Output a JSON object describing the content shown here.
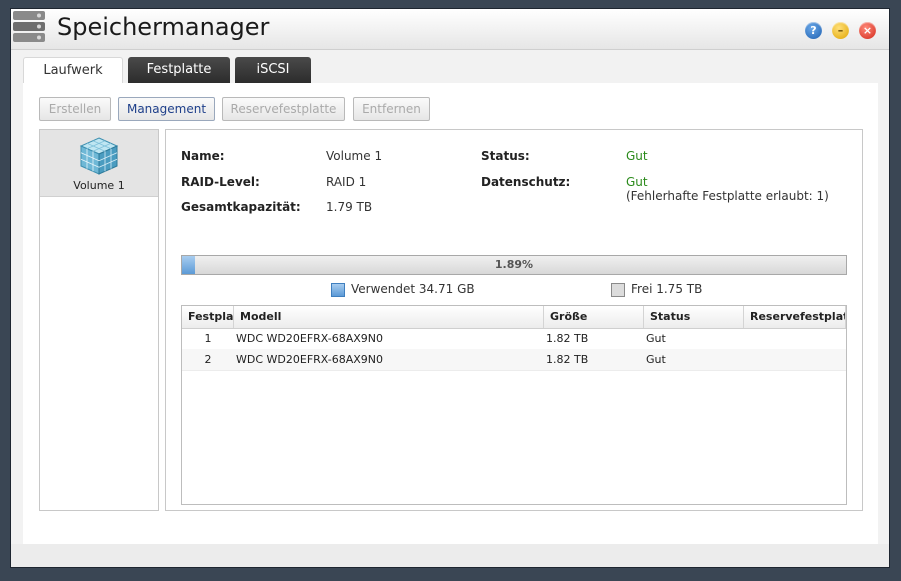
{
  "window": {
    "title": "Speichermanager"
  },
  "window_buttons": {
    "help": "?",
    "minimize": "–",
    "close": "×"
  },
  "tabs": [
    {
      "label": "Laufwerk",
      "active": true
    },
    {
      "label": "Festplatte",
      "active": false
    },
    {
      "label": "iSCSI",
      "active": false
    }
  ],
  "toolbar": {
    "create": "Erstellen",
    "management": "Management",
    "spare": "Reservefestplatte",
    "remove": "Entfernen"
  },
  "volumes": [
    {
      "label": "Volume 1"
    }
  ],
  "details": {
    "name_label": "Name:",
    "name_value": "Volume 1",
    "raid_label": "RAID-Level:",
    "raid_value": "RAID 1",
    "capacity_label": "Gesamtkapazität:",
    "capacity_value": "1.79 TB",
    "status_label": "Status:",
    "status_value": "Gut",
    "protection_label": "Datenschutz:",
    "protection_value": "Gut",
    "protection_note": "(Fehlerhafte Festplatte erlaubt: 1)"
  },
  "usage": {
    "percent_text": "1.89%",
    "percent": 1.89,
    "used_label": "Verwendet 34.71 GB",
    "free_label": "Frei 1.75 TB",
    "used_color": "#5c9ad6",
    "free_color": "#dcdcdc"
  },
  "disk_table": {
    "columns": [
      "Festplatte",
      "Modell",
      "Größe",
      "Status",
      "Reservefestplatte"
    ],
    "rows": [
      {
        "disk": "1",
        "model": "WDC WD20EFRX-68AX9N0",
        "size": "1.82 TB",
        "status": "Gut",
        "spare": ""
      },
      {
        "disk": "2",
        "model": "WDC WD20EFRX-68AX9N0",
        "size": "1.82 TB",
        "status": "Gut",
        "spare": ""
      }
    ]
  },
  "colors": {
    "good": "#2a8a1a",
    "accent": "#1e3f8a"
  }
}
